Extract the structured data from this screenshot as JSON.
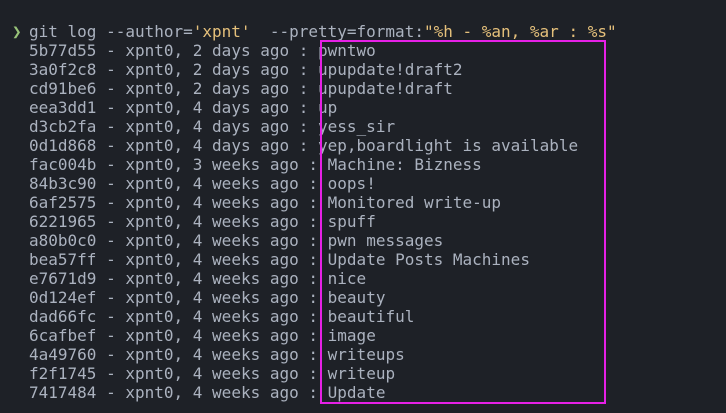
{
  "prompt_symbol": "❯",
  "command": {
    "pre": "git log --author=",
    "author_arg": "'xpnt'",
    "mid": "  --pretty=format:",
    "format_arg": "\"%h - %an, %ar : %s\""
  },
  "colors": {
    "background": "#1e2127",
    "text": "#abb2bf",
    "prompt": "#98c379",
    "string": "#e5c07b",
    "highlight_box": "#e620e6"
  },
  "log": [
    {
      "hash": "5b77d55",
      "author": "xpnt0",
      "age": "2 days ago",
      "subject": "pwntwo"
    },
    {
      "hash": "3a0f2c8",
      "author": "xpnt0",
      "age": "2 days ago",
      "subject": "upupdate!draft2"
    },
    {
      "hash": "cd91be6",
      "author": "xpnt0",
      "age": "2 days ago",
      "subject": "upupdate!draft"
    },
    {
      "hash": "eea3dd1",
      "author": "xpnt0",
      "age": "4 days ago",
      "subject": "up"
    },
    {
      "hash": "d3cb2fa",
      "author": "xpnt0",
      "age": "4 days ago",
      "subject": "yess_sir"
    },
    {
      "hash": "0d1d868",
      "author": "xpnt0",
      "age": "4 days ago",
      "subject": "yep,boardlight is available"
    },
    {
      "hash": "fac004b",
      "author": "xpnt0",
      "age": "3 weeks ago",
      "subject": "Machine: Bizness"
    },
    {
      "hash": "84b3c90",
      "author": "xpnt0",
      "age": "4 weeks ago",
      "subject": "oops!"
    },
    {
      "hash": "6af2575",
      "author": "xpnt0",
      "age": "4 weeks ago",
      "subject": "Monitored write-up"
    },
    {
      "hash": "6221965",
      "author": "xpnt0",
      "age": "4 weeks ago",
      "subject": "spuff"
    },
    {
      "hash": "a80b0c0",
      "author": "xpnt0",
      "age": "4 weeks ago",
      "subject": "pwn messages"
    },
    {
      "hash": "bea57ff",
      "author": "xpnt0",
      "age": "4 weeks ago",
      "subject": "Update Posts Machines"
    },
    {
      "hash": "e7671d9",
      "author": "xpnt0",
      "age": "4 weeks ago",
      "subject": "nice"
    },
    {
      "hash": "0d124ef",
      "author": "xpnt0",
      "age": "4 weeks ago",
      "subject": "beauty"
    },
    {
      "hash": "dad66fc",
      "author": "xpnt0",
      "age": "4 weeks ago",
      "subject": "beautiful"
    },
    {
      "hash": "6cafbef",
      "author": "xpnt0",
      "age": "4 weeks ago",
      "subject": "image"
    },
    {
      "hash": "4a49760",
      "author": "xpnt0",
      "age": "4 weeks ago",
      "subject": "writeups"
    },
    {
      "hash": "f2f1745",
      "author": "xpnt0",
      "age": "4 weeks ago",
      "subject": "writeup"
    },
    {
      "hash": "7417484",
      "author": "xpnt0",
      "age": "4 weeks ago",
      "subject": "Update"
    }
  ]
}
